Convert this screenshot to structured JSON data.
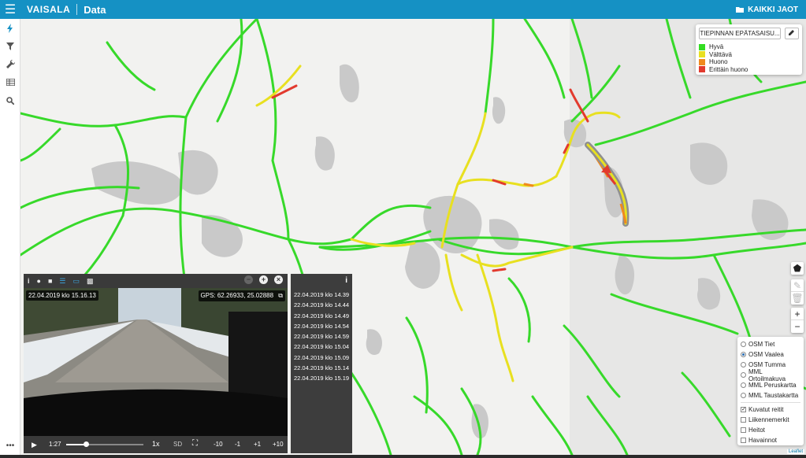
{
  "header": {
    "brand": "VAISALA",
    "title": "Data",
    "shares_label": "KAIKKI JAOT"
  },
  "sidebar": {
    "items": [
      {
        "icon": "lightning-icon"
      },
      {
        "icon": "filter-icon"
      },
      {
        "icon": "wrench-icon"
      },
      {
        "icon": "table-icon"
      },
      {
        "icon": "search-icon"
      }
    ],
    "more_label": "•••"
  },
  "legend": {
    "layer_button_label": "TIEPINNAN EPÄTASAISU...",
    "items": [
      {
        "label": "Hyvä",
        "color": "#33dd22"
      },
      {
        "label": "Välttävä",
        "color": "#e8e020"
      },
      {
        "label": "Huono",
        "color": "#f08a1e"
      },
      {
        "label": "Erittäin huono",
        "color": "#e23a2e"
      }
    ]
  },
  "map_controls": {
    "zoom_in": "+",
    "zoom_out": "−"
  },
  "layers": {
    "base": [
      {
        "label": "OSM Tiet",
        "selected": false
      },
      {
        "label": "OSM Vaalea",
        "selected": true
      },
      {
        "label": "OSM Tumma",
        "selected": false
      },
      {
        "label": "MML Ortoilmakuva",
        "selected": false
      },
      {
        "label": "MML Peruskartta",
        "selected": false
      },
      {
        "label": "MML Taustakartta",
        "selected": false
      }
    ],
    "overlays": [
      {
        "label": "Kuvatut reitit",
        "checked": true
      },
      {
        "label": "Liikennemerkit",
        "checked": false
      },
      {
        "label": "Heitot",
        "checked": false
      },
      {
        "label": "Havainnot",
        "checked": false
      }
    ]
  },
  "attribution": "Leaflet",
  "video": {
    "timestamp": "22.04.2019 klo 15.16.13",
    "gps": "GPS: 62.26933, 25.02888",
    "elapsed": "1:27",
    "speed": "1x",
    "quality": "SD",
    "progress": 0.25,
    "skip_buttons": [
      "-10",
      "-1",
      "+1",
      "+10"
    ]
  },
  "timestamps": [
    "22.04.2019 klo 14.39",
    "22.04.2019 klo 14.44",
    "22.04.2019 klo 14.49",
    "22.04.2019 klo 14.54",
    "22.04.2019 klo 14.59",
    "22.04.2019 klo 15.04",
    "22.04.2019 klo 15.09",
    "22.04.2019 klo 15.14",
    "22.04.2019 klo 15.19"
  ]
}
